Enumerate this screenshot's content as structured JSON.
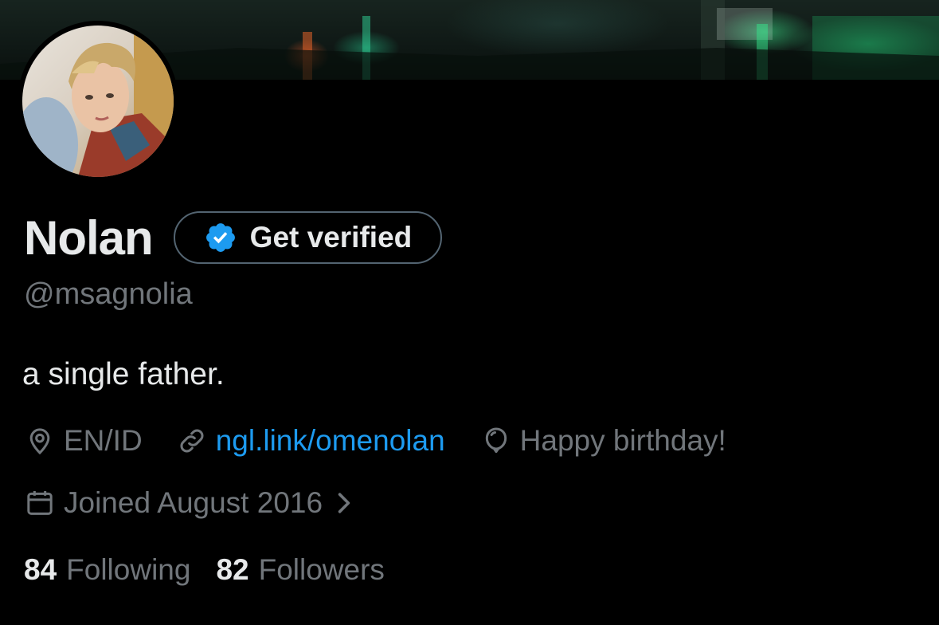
{
  "profile": {
    "display_name": "Nolan",
    "handle": "@msagnolia",
    "bio": "a single father.",
    "verify_button_label": "Get verified",
    "location": "EN/ID",
    "link": "ngl.link/omenolan",
    "birthday": "Happy birthday!",
    "joined": "Joined August 2016",
    "following_count": "84",
    "following_label": "Following",
    "followers_count": "82",
    "followers_label": "Followers"
  },
  "icons": {
    "verified": "verified-badge-icon",
    "location": "location-pin-icon",
    "link": "link-icon",
    "birthday": "balloon-icon",
    "joined": "calendar-icon",
    "chevron": "chevron-right-icon"
  },
  "colors": {
    "background": "#000000",
    "primary_text": "#e7e9ea",
    "secondary_text": "#71767b",
    "link": "#1d9bf0",
    "verified_badge": "#1d9bf0",
    "button_border": "#536471"
  }
}
